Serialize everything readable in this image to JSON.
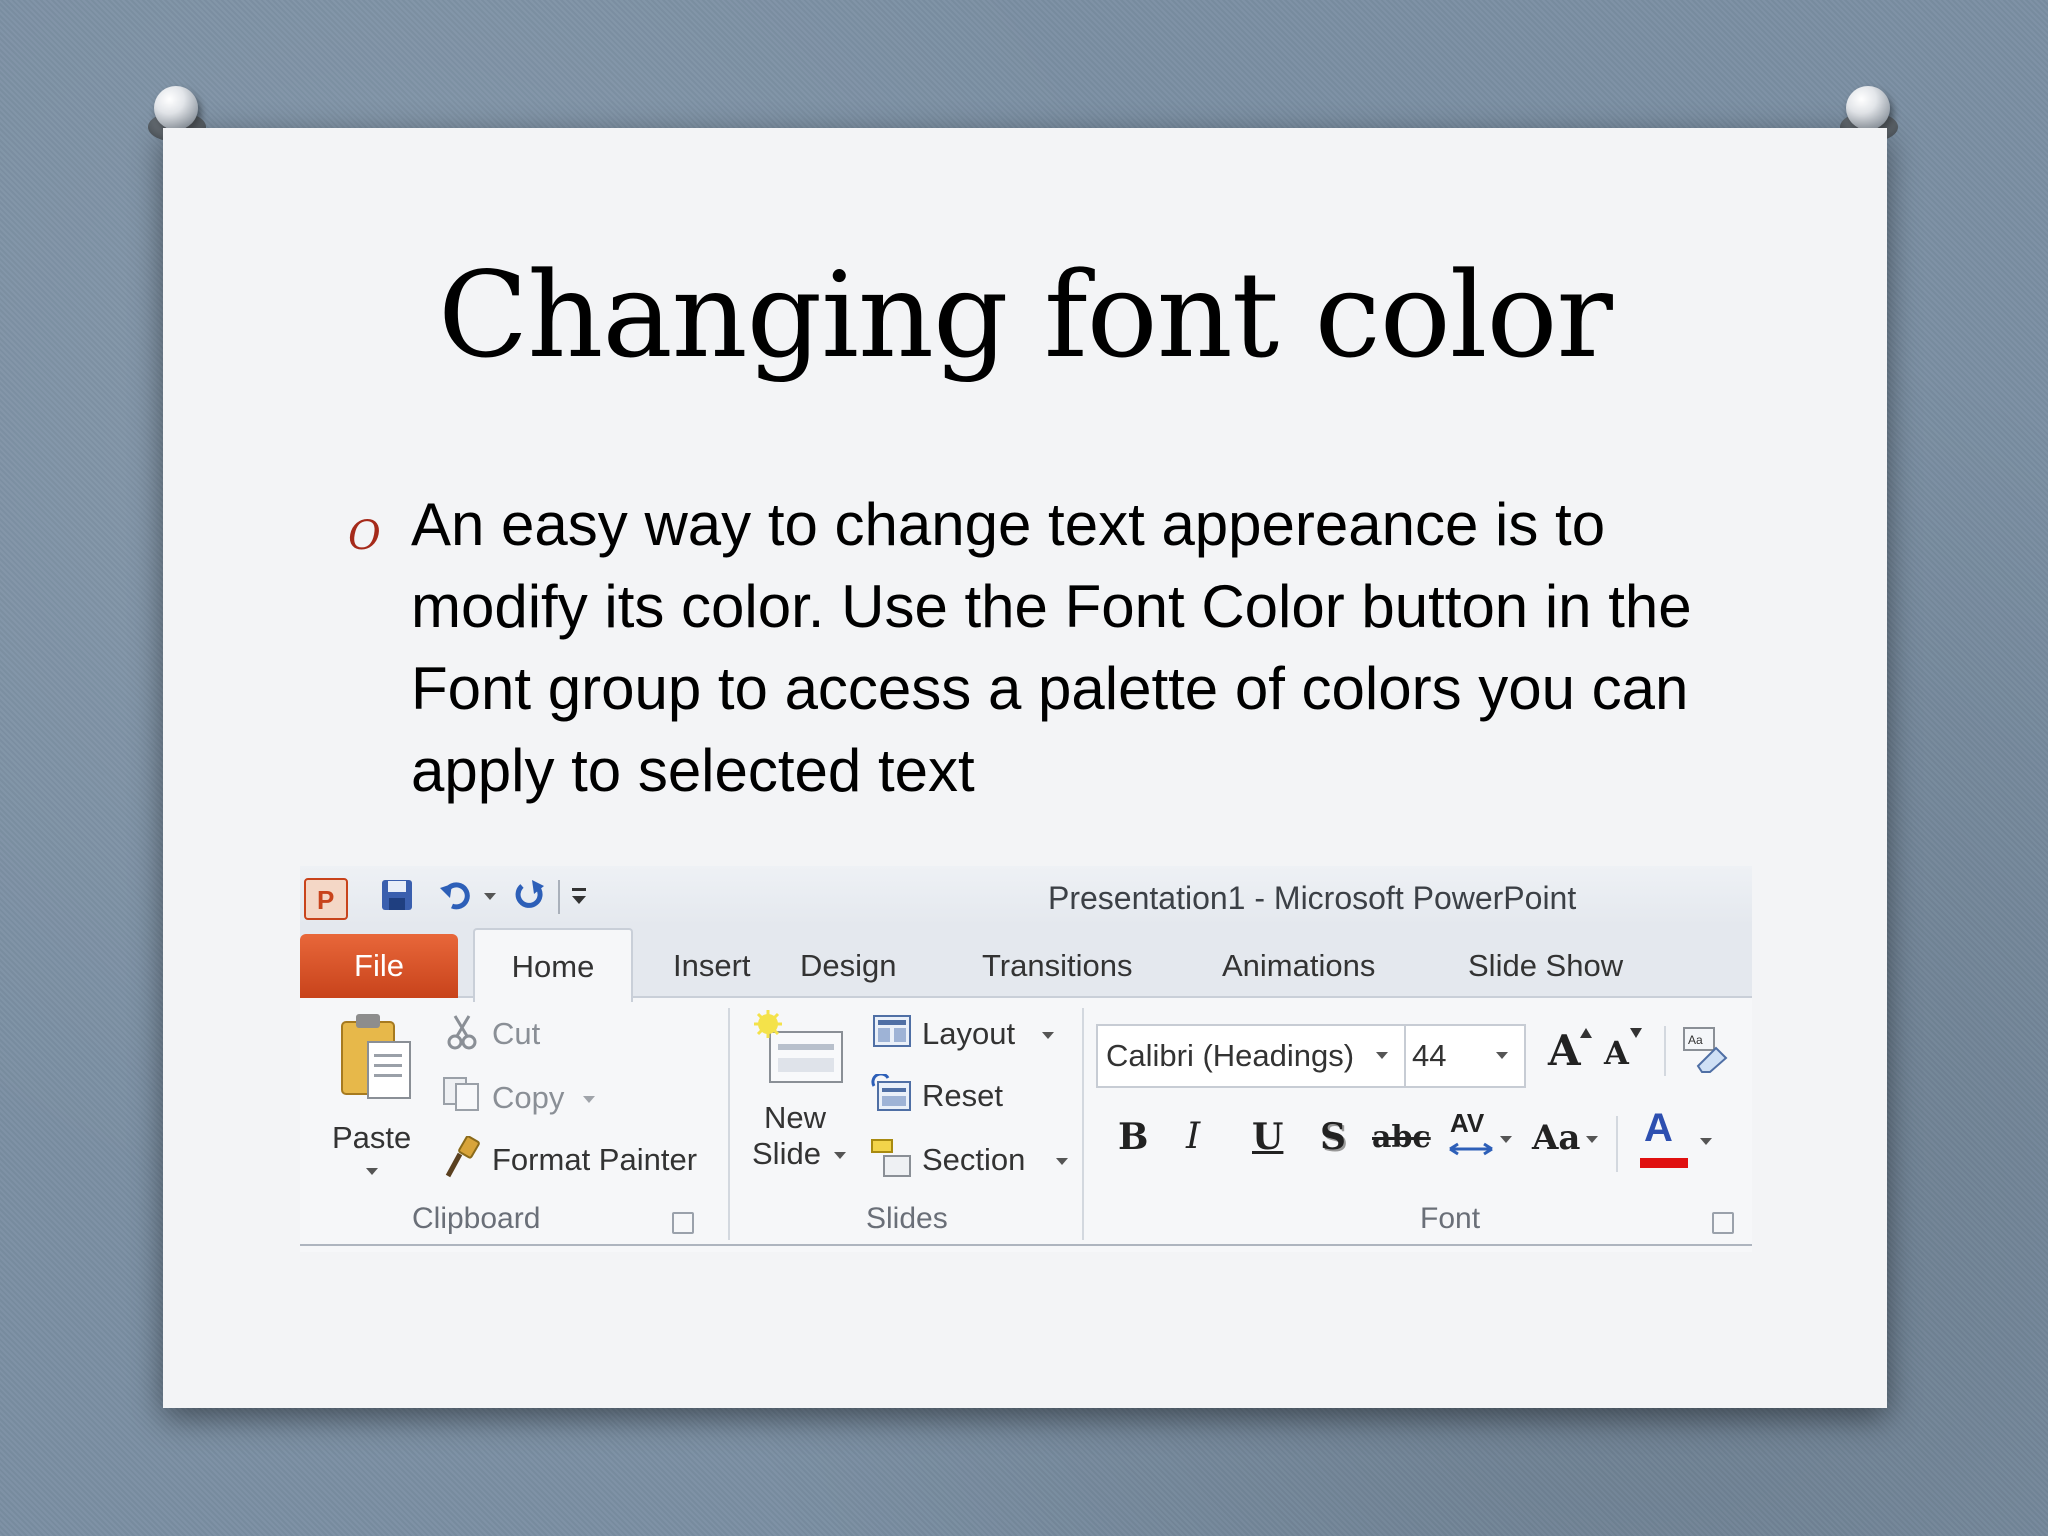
{
  "slide": {
    "title": "Changing font color",
    "bullet_marker": "O",
    "bullet_text": "An easy way to change text appereance is to modify its color. Use the Font Color button in the Font group to access a palette of colors you can apply to selected text"
  },
  "ribbon": {
    "window_title": "Presentation1  -  Microsoft PowerPoint",
    "tabs": {
      "file": "File",
      "home": "Home",
      "insert": "Insert",
      "design": "Design",
      "transitions": "Transitions",
      "animations": "Animations",
      "slide_show": "Slide Show"
    },
    "clipboard": {
      "paste": "Paste",
      "cut": "Cut",
      "copy": "Copy",
      "format_painter": "Format Painter",
      "group_label": "Clipboard"
    },
    "slides": {
      "new_slide_line1": "New",
      "new_slide_line2": "Slide",
      "layout": "Layout",
      "reset": "Reset",
      "section": "Section",
      "group_label": "Slides"
    },
    "font": {
      "font_name": "Calibri (Headings)",
      "font_size": "44",
      "grow": "A",
      "shrink": "A",
      "bold": "B",
      "italic": "I",
      "underline": "U",
      "shadow": "S",
      "strikethrough": "abc",
      "spacing": "AV",
      "change_case": "Aa",
      "font_color": "A",
      "group_label": "Font"
    },
    "colors": {
      "file_tab": "#d1501f",
      "font_color_bar": "#e01010",
      "bullet": "#a52a1a"
    }
  }
}
